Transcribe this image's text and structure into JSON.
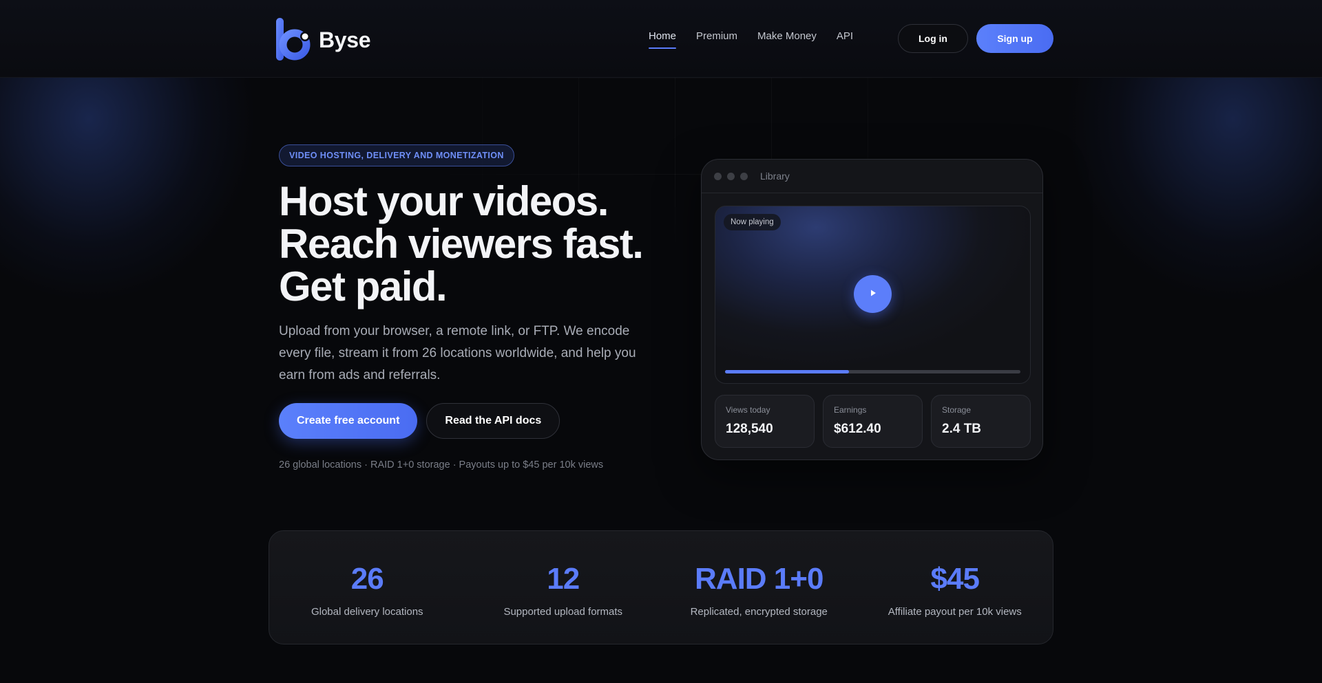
{
  "header": {
    "brand": "Byse",
    "nav": [
      {
        "label": "Home",
        "active": true
      },
      {
        "label": "Premium",
        "active": false
      },
      {
        "label": "Make Money",
        "active": false
      },
      {
        "label": "API",
        "active": false
      }
    ],
    "login_label": "Log in",
    "signup_label": "Sign up"
  },
  "hero": {
    "badge": "VIDEO HOSTING, DELIVERY AND MONETIZATION",
    "headline": [
      "Host your videos.",
      "Reach viewers fast.",
      "Get paid."
    ],
    "lead": "Upload from your browser, a remote link, or FTP. We encode every file, stream it from 26 locations worldwide, and help you earn from ads and referrals.",
    "primary_cta": "Create free account",
    "secondary_cta": "Read the API docs",
    "meta": "26 global locations · RAID 1+0 storage · Payouts up to $45 per 10k views"
  },
  "library": {
    "title": "Library",
    "now_playing": "Now playing",
    "progress": 0.42,
    "stats": [
      {
        "label": "Views today",
        "value": "128,540"
      },
      {
        "label": "Earnings",
        "value": "$612.40"
      },
      {
        "label": "Storage",
        "value": "2.4 TB"
      }
    ]
  },
  "highlights": [
    {
      "value": "26",
      "label": "Global delivery locations"
    },
    {
      "value": "12",
      "label": "Supported upload formats"
    },
    {
      "value": "RAID 1+0",
      "label": "Replicated, encrypted storage"
    },
    {
      "value": "$45",
      "label": "Affiliate payout per 10k views"
    }
  ],
  "colors": {
    "accent": "#5b7cfa",
    "background": "#07080b",
    "panel": "#141519"
  },
  "icons": {
    "logo": "byse-logo-icon",
    "play": "play-icon"
  }
}
